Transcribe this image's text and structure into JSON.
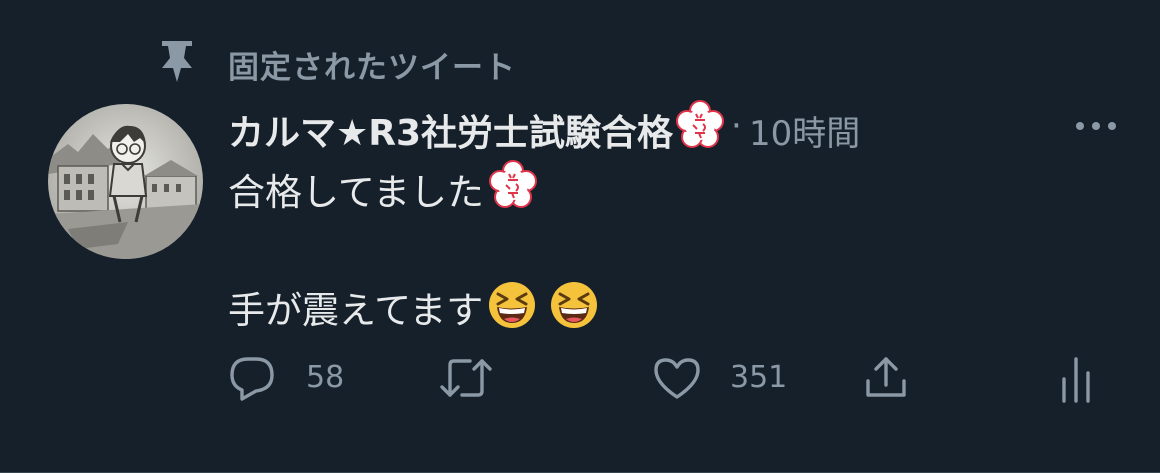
{
  "pinned": {
    "label": "固定されたツイート",
    "icon": "pin-icon"
  },
  "author": {
    "display_name": "カルマ★R3社労士試験合格",
    "avatar": "conan-sketch-avatar",
    "badge": "sakura-stamp-emoji"
  },
  "meta": {
    "separator": "·",
    "timestamp": "10時間"
  },
  "tweet": {
    "line1": "合格してました",
    "line2": "手が震えてます",
    "emojis": [
      "grinning-squinting-face",
      "grinning-squinting-face"
    ]
  },
  "actions": {
    "reply": {
      "icon": "reply-icon",
      "count": "58"
    },
    "retweet": {
      "icon": "retweet-icon",
      "count": ""
    },
    "like": {
      "icon": "heart-icon",
      "count": "351"
    },
    "share": {
      "icon": "share-icon"
    },
    "analytics": {
      "icon": "analytics-icon"
    }
  },
  "colors": {
    "background": "#15202b",
    "text_primary": "#e7e9ea",
    "text_secondary": "#8b98a5",
    "divider": "#38444d"
  }
}
